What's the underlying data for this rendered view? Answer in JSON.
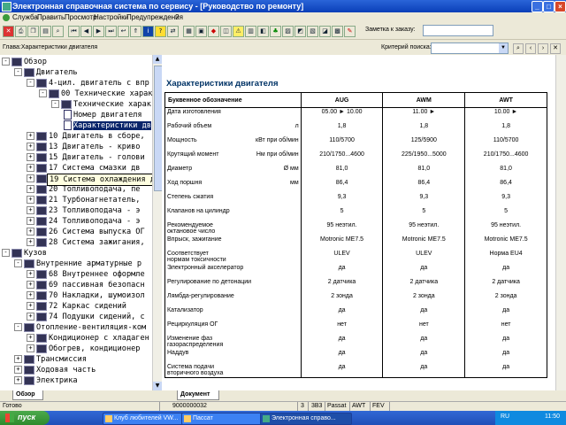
{
  "window": {
    "title": "Электронная справочная система по сервису - [Руководство по ремонту]"
  },
  "menu": [
    "Служба",
    "Править",
    "Просмотр",
    "Настройки",
    "Предупреждения",
    "?"
  ],
  "order_note": {
    "label": "Заметка к заказу:"
  },
  "address": {
    "chapter": "Глава:Характеристики двигателя",
    "search_label": "Критерий поиска:"
  },
  "tree": {
    "rows": [
      {
        "text": "Обзор",
        "icon": "book-open",
        "expander": "-"
      },
      {
        "text": "Двигатель",
        "icon": "book-open",
        "expander": "-"
      },
      {
        "text": "4-цил. двигатель с впр",
        "icon": "book-open",
        "expander": "-"
      },
      {
        "text": "00 Технические характ",
        "icon": "book-open",
        "expander": "-"
      },
      {
        "text": "Технические характе",
        "icon": "book-open",
        "expander": "-"
      },
      {
        "text": "Номер двигателя",
        "icon": "page",
        "expander": ""
      },
      {
        "text": "Характеристики дв",
        "icon": "page",
        "expander": "",
        "selected": true
      },
      {
        "text": "10 Двигатель в сборе,",
        "icon": "book",
        "expander": "+"
      },
      {
        "text": "13 Двигатель - криво",
        "icon": "book",
        "expander": "+"
      },
      {
        "text": "15 Двигатель - голови",
        "icon": "book",
        "expander": "+"
      },
      {
        "text": "17 Система смазки дв",
        "icon": "book",
        "expander": "+"
      },
      {
        "text": "19 Система охлаждения двигателя",
        "icon": "book",
        "expander": "+"
      },
      {
        "text": "20 Топливоподача, пе",
        "icon": "book",
        "expander": "+"
      },
      {
        "text": "21 Турбонагнетатель,",
        "icon": "book",
        "expander": "+"
      },
      {
        "text": "23 Топливоподача - э",
        "icon": "book",
        "expander": "+"
      },
      {
        "text": "24 Топливоподача - э",
        "icon": "book",
        "expander": "+"
      },
      {
        "text": "26 Система выпуска ОГ",
        "icon": "book",
        "expander": "+"
      },
      {
        "text": "28 Система зажигания,",
        "icon": "book",
        "expander": "+"
      },
      {
        "text": "Кузов",
        "icon": "book-open",
        "expander": "-"
      },
      {
        "text": "Внутренние арматурные р",
        "icon": "book-open",
        "expander": "-"
      },
      {
        "text": "68 Внутреннее оформле",
        "icon": "book",
        "expander": "+"
      },
      {
        "text": "69 пассивная безопасн",
        "icon": "book",
        "expander": "+"
      },
      {
        "text": "70 Накладки, шумоизол",
        "icon": "book",
        "expander": "+"
      },
      {
        "text": "72 Каркас сидений",
        "icon": "book",
        "expander": "+"
      },
      {
        "text": "74 Подушки сидений, с",
        "icon": "book",
        "expander": "+"
      },
      {
        "text": "Отопление-вентиляция-ком",
        "icon": "book-open",
        "expander": "-"
      },
      {
        "text": "Кондиционер с хладаген",
        "icon": "book",
        "expander": "+"
      },
      {
        "text": "Обогрев, кондиционер",
        "icon": "book",
        "expander": "+"
      },
      {
        "text": "Трансмиссия",
        "icon": "book",
        "expander": "+"
      },
      {
        "text": "Ходовая часть",
        "icon": "book",
        "expander": "+"
      },
      {
        "text": "Электрика",
        "icon": "book",
        "expander": "+"
      }
    ],
    "tooltip": "19 Система охлаждения двигателя",
    "tab": "Обзор"
  },
  "doc": {
    "title": "Характеристики двигателя",
    "headers": [
      "Буквенное обозначение",
      "AUG",
      "AWM",
      "AWT"
    ],
    "rows": [
      {
        "name": "Дата изготовления",
        "unit": "",
        "v": [
          "05.00 ► 10.00",
          "11.00 ►",
          "10.00 ►"
        ]
      },
      {
        "name": "Рабочий объем",
        "unit": "л",
        "v": [
          "1,8",
          "1,8",
          "1,8"
        ]
      },
      {
        "name": "Мощность",
        "unit": "кВт при об/мин",
        "v": [
          "110/5700",
          "125/5900",
          "110/5700"
        ]
      },
      {
        "name": "Крутящий момент",
        "unit": "Нм при об/мин",
        "v": [
          "210/1750...4600",
          "225/1950...5000",
          "210/1750...4600"
        ]
      },
      {
        "name": "Диаметр",
        "unit": "Ø мм",
        "v": [
          "81,0",
          "81,0",
          "81,0"
        ]
      },
      {
        "name": "Ход поршня",
        "unit": "мм",
        "v": [
          "86,4",
          "86,4",
          "86,4"
        ]
      },
      {
        "name": "Степень сжатия",
        "unit": "",
        "v": [
          "9,3",
          "9,3",
          "9,3"
        ]
      },
      {
        "name": "Клапанов на цилиндр",
        "unit": "",
        "v": [
          "5",
          "5",
          "5"
        ]
      },
      {
        "name": "Рекомендуемое октановое число",
        "unit": "",
        "v": [
          "95 неэтил.",
          "95 неэтил.",
          "95 неэтил."
        ]
      },
      {
        "name": "Впрыск, зажигание",
        "unit": "",
        "v": [
          "Motronic ME7.5",
          "Motronic ME7.5",
          "Motronic ME7.5"
        ]
      },
      {
        "name": "Соответствует нормам токсичности",
        "unit": "",
        "v": [
          "ULEV",
          "ULEV",
          "Норма EU4"
        ]
      },
      {
        "name": "Электронный акселератор",
        "unit": "",
        "v": [
          "да",
          "да",
          "да"
        ]
      },
      {
        "name": "Регулирование по детонации",
        "unit": "",
        "v": [
          "2 датчика",
          "2 датчика",
          "2 датчика"
        ]
      },
      {
        "name": "Лямбда-регулирование",
        "unit": "",
        "v": [
          "2 зонда",
          "2 зонда",
          "2 зонда"
        ]
      },
      {
        "name": "Катализатор",
        "unit": "",
        "v": [
          "да",
          "да",
          "да"
        ]
      },
      {
        "name": "Рециркуляция ОГ",
        "unit": "",
        "v": [
          "нет",
          "нет",
          "нет"
        ]
      },
      {
        "name": "Изменение фаз газораспределения",
        "unit": "",
        "v": [
          "да",
          "да",
          "да"
        ]
      },
      {
        "name": "Наддув",
        "unit": "",
        "v": [
          "да",
          "да",
          "да"
        ]
      },
      {
        "name": "Система подачи вторичного воздуха",
        "unit": "",
        "v": [
          "да",
          "да",
          "да"
        ]
      }
    ],
    "tab": "Документ"
  },
  "status": {
    "left": "Готово",
    "code": "9000000032",
    "num": "3",
    "model_code": "3В3",
    "model": "Passat",
    "engine": "AWT",
    "flag": "FEV"
  },
  "taskbar": {
    "start": "пуск",
    "tasks": [
      "Клуб любителей VW...",
      "Пассат",
      "Электронная справо..."
    ],
    "lang": "RU",
    "clock": "11:50"
  }
}
